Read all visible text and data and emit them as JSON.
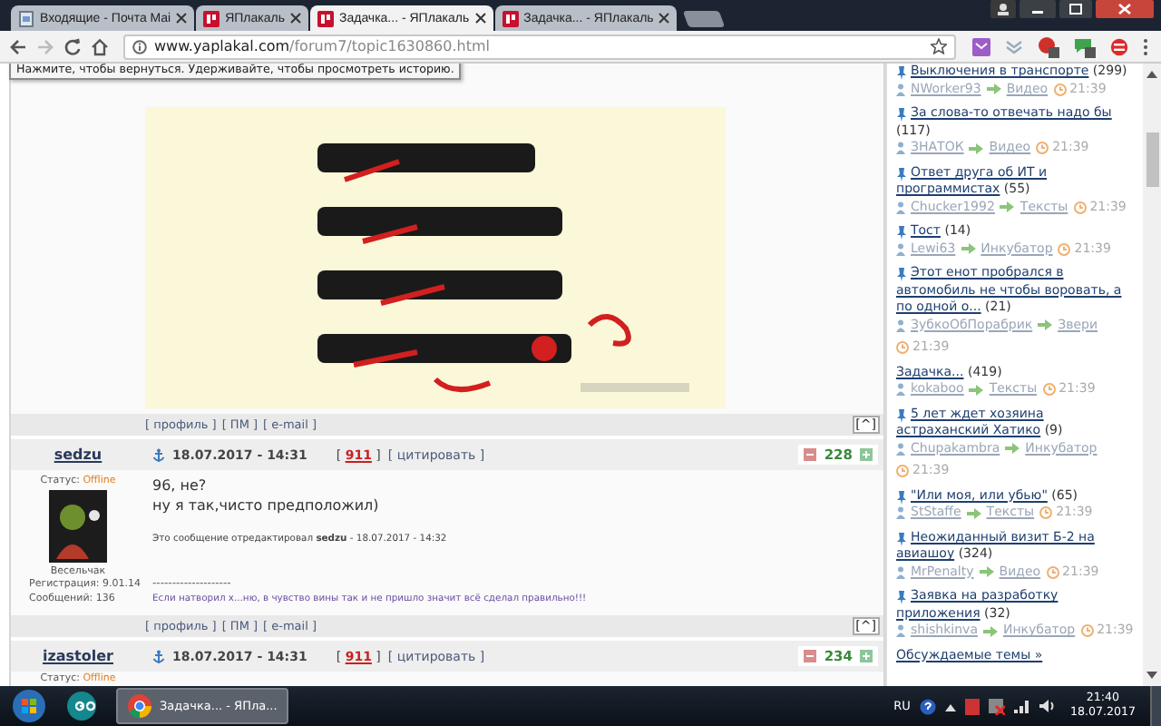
{
  "browser": {
    "tabs": [
      {
        "kind": "mail",
        "title": "Входящие - Почта Mai",
        "selected": false
      },
      {
        "kind": "site",
        "title": "ЯПлакаль",
        "selected": false
      },
      {
        "kind": "site",
        "title": "Задачка... - ЯПлакаль",
        "selected": true
      },
      {
        "kind": "site",
        "title": "Задачка... - ЯПлакаль",
        "selected": false
      }
    ],
    "url_domain": "www.yaplakal.com",
    "url_path": "/forum7/topic1630860.html",
    "tooltip": "Нажмите, чтобы вернуться. Удерживайте, чтобы просмотреть историю."
  },
  "posts": [
    {
      "kind": "picture",
      "links": [
        "[ профиль ]",
        "[ ПМ ]",
        "[ e-mail ]"
      ],
      "top_link": "[^]"
    },
    {
      "kind": "full",
      "author": "sedzu",
      "status_label": "Статус:",
      "status": "Offline",
      "rank": "Весельчак",
      "registered": "Регистрация: 9.01.14",
      "messages": "Сообщений: 136",
      "date": "18.07.2017 - 14:31",
      "number": "[ **911** ]",
      "quote": "[ цитировать ]",
      "rating": "228",
      "body": [
        "96, не?",
        "ну я так,чисто предположил)"
      ],
      "edited": "Это сообщение отредактировал **sedzu** - 18.07.2017 - 14:32",
      "separator": "--------------------",
      "signature": "Если натворил х...ню, в чувство вины так и не пришло значит всё сделал правильно!!!",
      "links": [
        "[ профиль ]",
        "[ ПМ ]",
        "[ e-mail ]"
      ],
      "top_link": "[^]"
    },
    {
      "kind": "partial",
      "author": "izastoler",
      "status_label": "Статус:",
      "status": "Offline",
      "date": "18.07.2017 - 14:31",
      "number": "[ **911** ]",
      "quote": "[ цитировать ]",
      "rating": "234"
    }
  ],
  "sidebar": {
    "items": [
      {
        "title": "Выключения в транспорте",
        "count": "(299)",
        "author": "NWorker93",
        "category": "Видео",
        "time": "21:39",
        "current": false
      },
      {
        "title": "За слова-то отвечать надо бы",
        "count": "(117)",
        "author": "ЗНАТОК",
        "category": "Видео",
        "time": "21:39",
        "current": false
      },
      {
        "title": "Ответ друга об ИТ и программистах",
        "count": "(55)",
        "author": "Chucker1992",
        "category": "Тексты",
        "time": "21:39",
        "current": false
      },
      {
        "title": "Тост",
        "count": "(14)",
        "author": "Lewi63",
        "category": "Инкубатор",
        "time": "21:39",
        "current": false
      },
      {
        "title": "Этот енот пробрался в автомобиль не чтобы воровать, а по одной о...",
        "count": "(21)",
        "author": "ЗубкоОбПорабрик",
        "category": "Звери",
        "time": "21:39",
        "current": false
      },
      {
        "title": "Задачка...",
        "count": "(419)",
        "author": "kokaboo",
        "category": "Тексты",
        "time": "21:39",
        "current": true
      },
      {
        "title": "5 лет ждет хозяина астраханский Хатико",
        "count": "(9)",
        "author": "Chupakambra",
        "category": "Инкубатор",
        "time": "21:39",
        "current": false
      },
      {
        "title": "\"Или моя, или убью\"",
        "count": "(65)",
        "author": "StStaffe",
        "category": "Тексты",
        "time": "21:39",
        "current": false
      },
      {
        "title": "Неожиданный визит Б-2 на авиашоу",
        "count": "(324)",
        "author": "MrPenalty",
        "category": "Видео",
        "time": "21:39",
        "current": false
      },
      {
        "title": "Заявка на разработку приложения",
        "count": "(32)",
        "author": "shishkinva",
        "category": "Инкубатор",
        "time": "21:39",
        "current": false
      }
    ],
    "more": "Обсуждаемые темы »"
  },
  "taskbar": {
    "apps": [
      {
        "kind": "arduino",
        "selected": false
      },
      {
        "kind": "chrome",
        "label": "Задачка... - ЯПла...",
        "selected": true
      }
    ],
    "language": "RU",
    "time": "21:40",
    "date": "18.07.2017"
  }
}
